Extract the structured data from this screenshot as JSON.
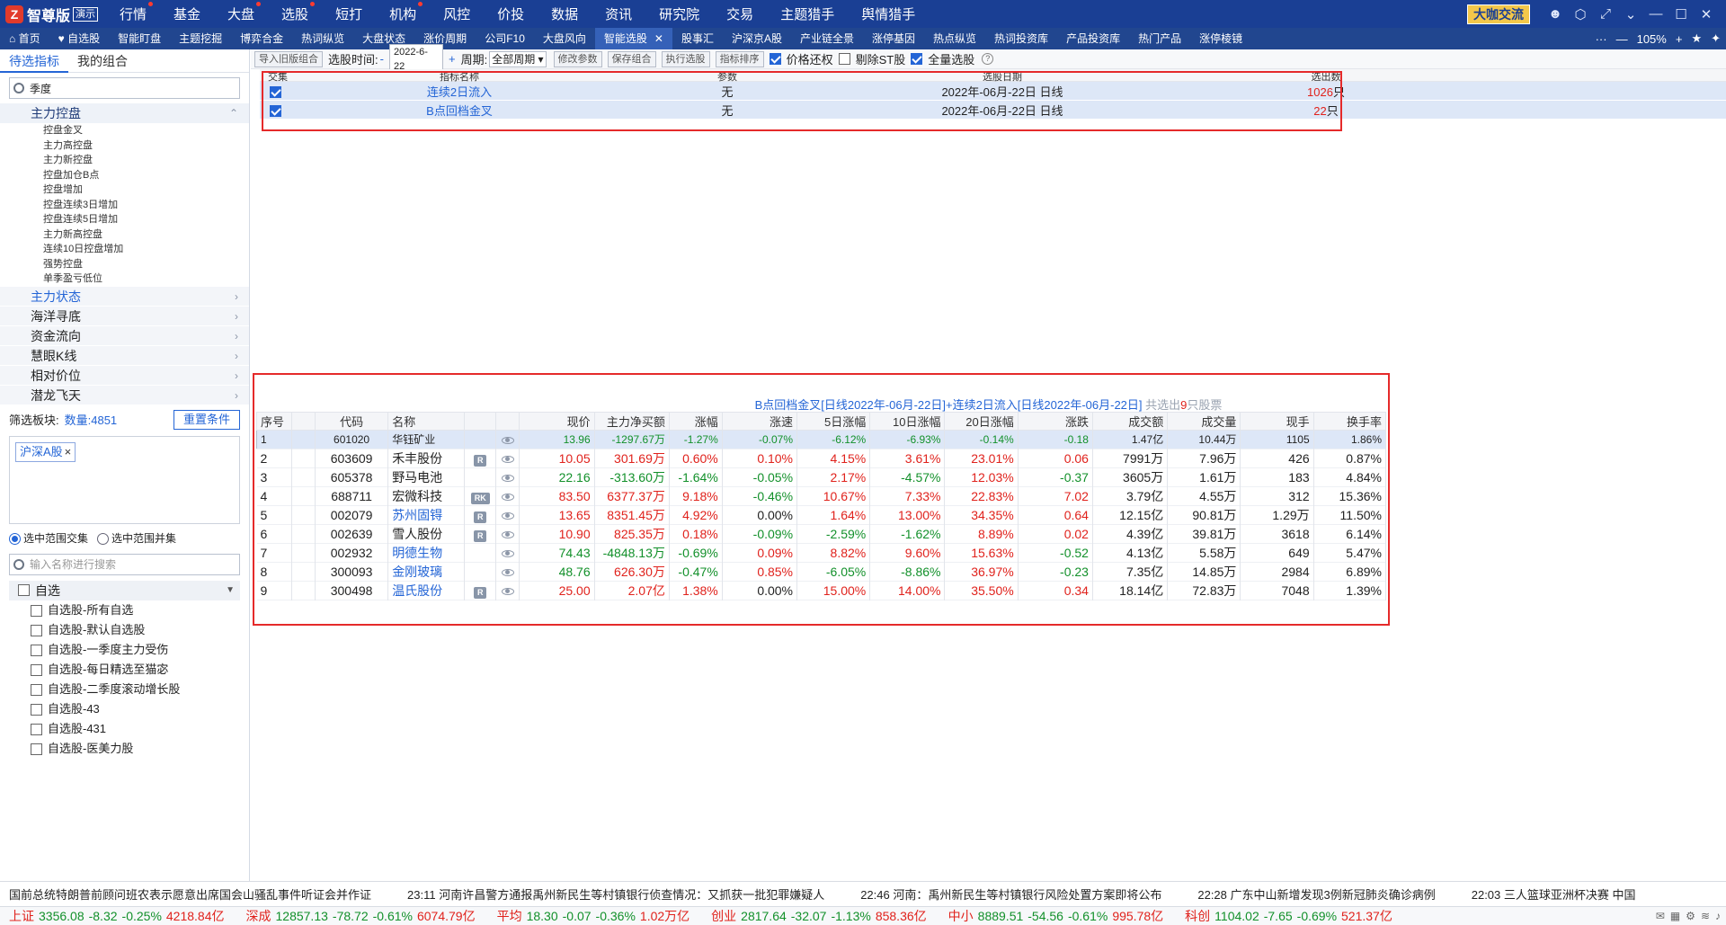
{
  "app": {
    "logo_text": "智尊版",
    "demo_badge": "演示",
    "daka_button": "大咖交流"
  },
  "topnav": [
    {
      "label": "行情",
      "dot": true
    },
    {
      "label": "基金",
      "dot": false
    },
    {
      "label": "大盘",
      "dot": true
    },
    {
      "label": "选股",
      "dot": true
    },
    {
      "label": "短打",
      "dot": false
    },
    {
      "label": "机构",
      "dot": true
    },
    {
      "label": "风控",
      "dot": false
    },
    {
      "label": "价投",
      "dot": false
    },
    {
      "label": "数据",
      "dot": false
    },
    {
      "label": "资讯",
      "dot": false
    },
    {
      "label": "研究院",
      "dot": false
    },
    {
      "label": "交易",
      "dot": false
    },
    {
      "label": "主题猎手",
      "dot": false
    },
    {
      "label": "舆情猎手",
      "dot": false
    }
  ],
  "tabs": [
    {
      "label": "首页",
      "active": false
    },
    {
      "label": "自选股",
      "active": false
    },
    {
      "label": "智能盯盘",
      "active": false
    },
    {
      "label": "主题挖掘",
      "active": false
    },
    {
      "label": "博弈合金",
      "active": false
    },
    {
      "label": "热词纵览",
      "active": false
    },
    {
      "label": "大盘状态",
      "active": false
    },
    {
      "label": "涨价周期",
      "active": false
    },
    {
      "label": "公司F10",
      "active": false
    },
    {
      "label": "大盘风向",
      "active": false
    },
    {
      "label": "智能选股",
      "active": true
    },
    {
      "label": "股事汇",
      "active": false
    },
    {
      "label": "沪深京A股",
      "active": false
    },
    {
      "label": "产业链全景",
      "active": false
    },
    {
      "label": "涨停基因",
      "active": false
    },
    {
      "label": "热点纵览",
      "active": false
    },
    {
      "label": "热词投资库",
      "active": false
    },
    {
      "label": "产品投资库",
      "active": false
    },
    {
      "label": "热门产品",
      "active": false
    },
    {
      "label": "涨停棱镜",
      "active": false
    }
  ],
  "tab_controls": {
    "more": "···",
    "zoom": "105%"
  },
  "left": {
    "tabs": [
      "待选指标",
      "我的组合"
    ],
    "search_value": "季度",
    "group_label": "主力控盘",
    "leaves": [
      "控盘金叉",
      "主力高控盘",
      "主力新控盘",
      "控盘加仓B点",
      "控盘增加",
      "控盘连续3日增加",
      "控盘连续5日增加",
      "主力新高控盘",
      "连续10日控盘增加",
      "强势控盘",
      "单季盈亏低位"
    ],
    "categories": [
      {
        "label": "主力状态",
        "blue": true
      },
      {
        "label": "海洋寻底",
        "blue": false
      },
      {
        "label": "资金流向",
        "blue": false
      },
      {
        "label": "慧眼K线",
        "blue": false
      },
      {
        "label": "相对价位",
        "blue": false
      },
      {
        "label": "潜龙飞天",
        "blue": false
      }
    ],
    "filter_label": "筛选板块:",
    "filter_count": "数量:4851",
    "reset_button": "重置条件",
    "plate_tag": "沪深A股",
    "radio_intersect": "选中范围交集",
    "radio_union": "选中范围并集",
    "name_search_placeholder": "输入名称进行搜索",
    "list_head": "自选",
    "list_items": [
      "自选股-所有自选",
      "自选股-默认自选股",
      "自选股-一季度主力受伤",
      "自选股-每日精选至猫宓",
      "自选股-二季度滚动增长股",
      "自选股-43",
      "自选股-431",
      "自选股-医美力股"
    ]
  },
  "toolbar": {
    "import_button": "导入旧版组合",
    "time_label": "选股时间:",
    "minus": "-",
    "date_value": "2022-6-22",
    "plus": "+",
    "period_label": "周期:",
    "period_value": "全部周期",
    "modify_button": "修改参数",
    "save_button": "保存组合",
    "run_button": "执行选股",
    "sort_button": "指标排序",
    "price_restore": "价格还权",
    "exclude_st": "剔除ST股",
    "all_select": "全量选股",
    "help": "?"
  },
  "indicator_table": {
    "headers": [
      "交集",
      "指标名称",
      "参数",
      "选股日期",
      "选出数"
    ],
    "rows": [
      {
        "name": "连续2日流入",
        "param": "无",
        "date": "2022年-06月-22日 日线",
        "count": "1026",
        "unit": "只"
      },
      {
        "name": "B点回档金叉",
        "param": "无",
        "date": "2022年-06月-22日 日线",
        "count": "22",
        "unit": "只"
      }
    ]
  },
  "result": {
    "title": "B点回档金叉[日线2022年-06月-22日]+连续2日流入[日线2022年-06月-22日]",
    "summary_prefix": "共选出",
    "summary_count": "9",
    "summary_suffix": "只股票",
    "headers": [
      "序号",
      "",
      "代码",
      "名称",
      "",
      "",
      "现价",
      "主力净买额",
      "涨幅",
      "涨速",
      "5日涨幅",
      "10日涨幅",
      "20日涨幅",
      "涨跌",
      "成交额",
      "成交量",
      "现手",
      "换手率"
    ],
    "rows": [
      {
        "no": "1",
        "code": "601020",
        "name": "华钰矿业",
        "name_blue": false,
        "tag": "",
        "price": "13.96",
        "net": "-1297.67万",
        "chg": "-1.27%",
        "speed": "-0.07%",
        "d5": "-6.12%",
        "d10": "-6.93%",
        "d20": "-0.14%",
        "diff": "-0.18",
        "amount": "1.47亿",
        "vol": "10.44万",
        "hand": "1105",
        "turn": "1.86%"
      },
      {
        "no": "2",
        "code": "603609",
        "name": "禾丰股份",
        "name_blue": false,
        "tag": "R",
        "price": "10.05",
        "net": "301.69万",
        "chg": "0.60%",
        "speed": "0.10%",
        "d5": "4.15%",
        "d10": "3.61%",
        "d20": "23.01%",
        "diff": "0.06",
        "amount": "7991万",
        "vol": "7.96万",
        "hand": "426",
        "turn": "0.87%"
      },
      {
        "no": "3",
        "code": "605378",
        "name": "野马电池",
        "name_blue": false,
        "tag": "",
        "price": "22.16",
        "net": "-313.60万",
        "chg": "-1.64%",
        "speed": "-0.05%",
        "d5": "2.17%",
        "d10": "-4.57%",
        "d20": "12.03%",
        "diff": "-0.37",
        "amount": "3605万",
        "vol": "1.61万",
        "hand": "183",
        "turn": "4.84%"
      },
      {
        "no": "4",
        "code": "688711",
        "name": "宏微科技",
        "name_blue": false,
        "tag": "RK",
        "price": "83.50",
        "net": "6377.37万",
        "chg": "9.18%",
        "speed": "-0.46%",
        "d5": "10.67%",
        "d10": "7.33%",
        "d20": "22.83%",
        "diff": "7.02",
        "amount": "3.79亿",
        "vol": "4.55万",
        "hand": "312",
        "turn": "15.36%"
      },
      {
        "no": "5",
        "code": "002079",
        "name": "苏州固锝",
        "name_blue": true,
        "tag": "R",
        "price": "13.65",
        "net": "8351.45万",
        "chg": "4.92%",
        "speed": "0.00%",
        "d5": "1.64%",
        "d10": "13.00%",
        "d20": "34.35%",
        "diff": "0.64",
        "amount": "12.15亿",
        "vol": "90.81万",
        "hand": "1.29万",
        "turn": "11.50%"
      },
      {
        "no": "6",
        "code": "002639",
        "name": "雪人股份",
        "name_blue": false,
        "tag": "R",
        "price": "10.90",
        "net": "825.35万",
        "chg": "0.18%",
        "speed": "-0.09%",
        "d5": "-2.59%",
        "d10": "-1.62%",
        "d20": "8.89%",
        "diff": "0.02",
        "amount": "4.39亿",
        "vol": "39.81万",
        "hand": "3618",
        "turn": "6.14%"
      },
      {
        "no": "7",
        "code": "002932",
        "name": "明德生物",
        "name_blue": true,
        "tag": "",
        "price": "74.43",
        "net": "-4848.13万",
        "chg": "-0.69%",
        "speed": "0.09%",
        "d5": "8.82%",
        "d10": "9.60%",
        "d20": "15.63%",
        "diff": "-0.52",
        "amount": "4.13亿",
        "vol": "5.58万",
        "hand": "649",
        "turn": "5.47%"
      },
      {
        "no": "8",
        "code": "300093",
        "name": "金刚玻璃",
        "name_blue": true,
        "tag": "",
        "price": "48.76",
        "net": "626.30万",
        "chg": "-0.47%",
        "speed": "0.85%",
        "d5": "-6.05%",
        "d10": "-8.86%",
        "d20": "36.97%",
        "diff": "-0.23",
        "amount": "7.35亿",
        "vol": "14.85万",
        "hand": "2984",
        "turn": "6.89%"
      },
      {
        "no": "9",
        "code": "300498",
        "name": "温氏股份",
        "name_blue": true,
        "tag": "R",
        "price": "25.00",
        "net": "2.07亿",
        "chg": "1.38%",
        "speed": "0.00%",
        "d5": "15.00%",
        "d10": "14.00%",
        "d20": "35.50%",
        "diff": "0.34",
        "amount": "18.14亿",
        "vol": "72.83万",
        "hand": "7048",
        "turn": "1.39%"
      }
    ]
  },
  "news": [
    "国前总统特朗普前顾问班农表示愿意出席国会山骚乱事件听证会并作证",
    "23:11 河南许昌警方通报禹州新民生等村镇银行侦查情况：又抓获一批犯罪嫌疑人",
    "22:46 河南：禹州新民生等村镇银行风险处置方案即将公布",
    "22:28 广东中山新增发现3例新冠肺炎确诊病例",
    "22:03 三人篮球亚洲杯决赛 中国"
  ],
  "indices": [
    {
      "name": "上证",
      "value": "3356.08",
      "chg": "-8.32",
      "pct": "-0.25%",
      "amount": "4218.84亿"
    },
    {
      "name": "深成",
      "value": "12857.13",
      "chg": "-78.72",
      "pct": "-0.61%",
      "amount": "6074.79亿"
    },
    {
      "name": "平均",
      "value": "18.30",
      "chg": "-0.07",
      "pct": "-0.36%",
      "amount": "1.02万亿"
    },
    {
      "name": "创业",
      "value": "2817.64",
      "chg": "-32.07",
      "pct": "-1.13%",
      "amount": "858.36亿"
    },
    {
      "name": "中小",
      "value": "8889.51",
      "chg": "-54.56",
      "pct": "-0.61%",
      "amount": "995.78亿"
    },
    {
      "name": "科创",
      "value": "1104.02",
      "chg": "-7.65",
      "pct": "-0.69%",
      "amount": "521.37亿"
    }
  ]
}
